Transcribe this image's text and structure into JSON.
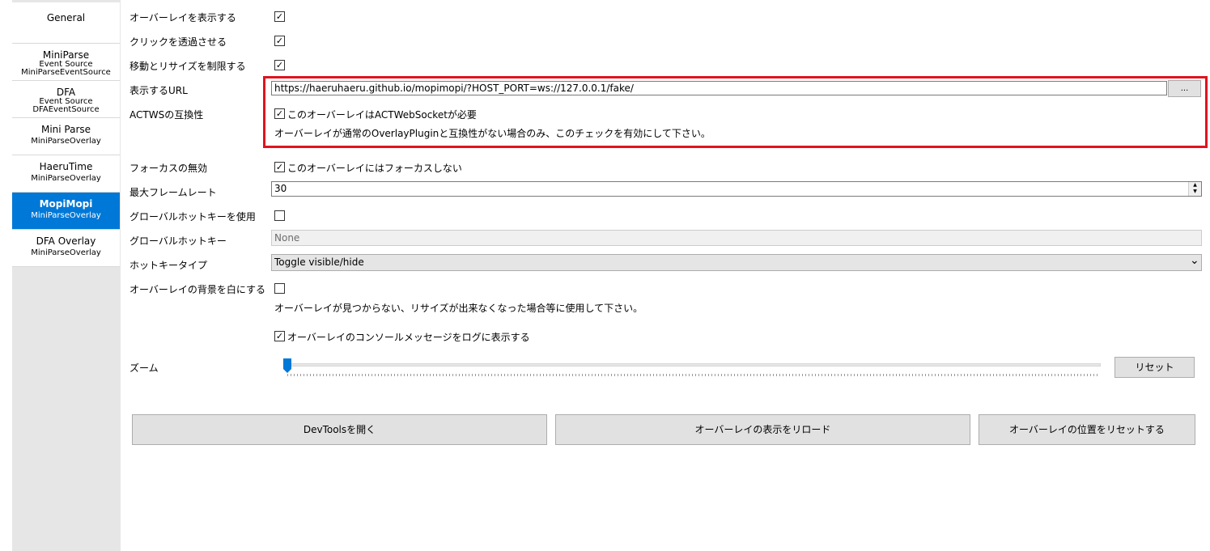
{
  "sidebar": {
    "items": [
      {
        "line1": "General",
        "line2": "",
        "line3": "",
        "selected": false
      },
      {
        "line1": "MiniParse",
        "line2": "Event Source",
        "line3": "MiniParseEventSource",
        "selected": false
      },
      {
        "line1": "DFA",
        "line2": "Event Source",
        "line3": "DFAEventSource",
        "selected": false
      },
      {
        "line1": "Mini Parse",
        "line2": "MiniParseOverlay",
        "line3": "",
        "selected": false
      },
      {
        "line1": "HaeruTime",
        "line2": "MiniParseOverlay",
        "line3": "",
        "selected": false
      },
      {
        "line1": "MopiMopi",
        "line2": "MiniParseOverlay",
        "line3": "",
        "selected": true
      },
      {
        "line1": "DFA Overlay",
        "line2": "MiniParseOverlay",
        "line3": "",
        "selected": false
      }
    ]
  },
  "settings": {
    "show_overlay": {
      "label": "オーバーレイを表示する",
      "checked": true
    },
    "click_through": {
      "label": "クリックを透過させる",
      "checked": true
    },
    "lock_move_resize": {
      "label": "移動とリサイズを制限する",
      "checked": true
    },
    "url": {
      "label": "表示するURL",
      "value": "https://haeruhaeru.github.io/mopimopi/?HOST_PORT=ws://127.0.0.1/fake/",
      "browse_label": "..."
    },
    "actws": {
      "label": "ACTWSの互換性",
      "checkbox_label": "このオーバーレイはACTWebSocketが必要",
      "checked": true,
      "hint": "オーバーレイが通常のOverlayPluginと互換性がない場合のみ、このチェックを有効にして下さい。"
    },
    "disable_focus": {
      "label": "フォーカスの無効",
      "checkbox_label": "このオーバーレイにはフォーカスしない",
      "checked": true
    },
    "max_framerate": {
      "label": "最大フレームレート",
      "value": "30"
    },
    "global_hotkey_enable": {
      "label": "グローバルホットキーを使用",
      "checked": false
    },
    "global_hotkey": {
      "label": "グローバルホットキー",
      "value": "None"
    },
    "hotkey_type": {
      "label": "ホットキータイプ",
      "value": "Toggle visible/hide"
    },
    "white_bg": {
      "label": "オーバーレイの背景を白にする",
      "checked": false,
      "hint": "オーバーレイが見つからない、リサイズが出来なくなった場合等に使用して下さい。"
    },
    "console_log": {
      "checkbox_label": "オーバーレイのコンソールメッセージをログに表示する",
      "checked": true
    },
    "zoom": {
      "label": "ズーム",
      "value": 0,
      "reset_label": "リセット"
    }
  },
  "buttons": {
    "devtools": "DevToolsを開く",
    "reload": "オーバーレイの表示をリロード",
    "reset_position": "オーバーレイの位置をリセットする"
  },
  "glyphs": {
    "check": "✓",
    "spin_up": "▲",
    "spin_down": "▼",
    "chevron": "⌄"
  },
  "colors": {
    "selection": "#0078d7",
    "highlight_box": "#e0141e"
  }
}
